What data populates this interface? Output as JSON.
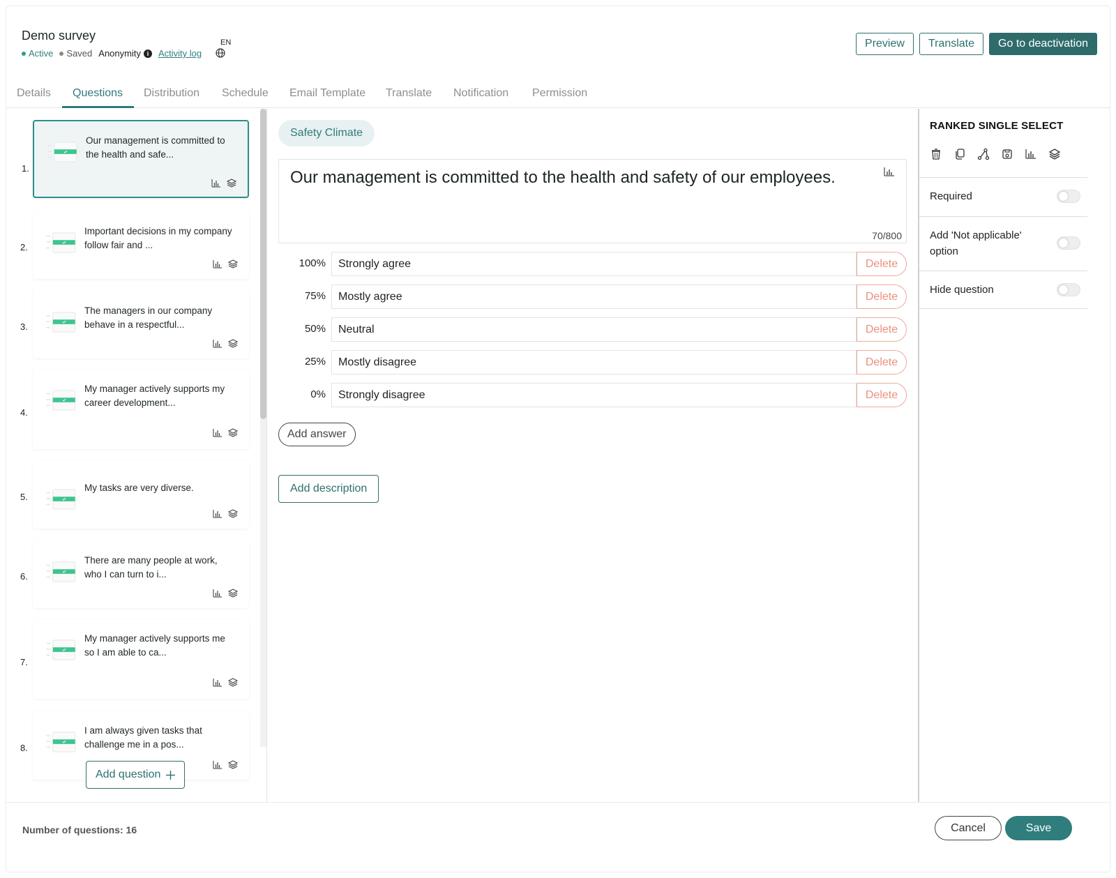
{
  "survey": {
    "title": "Demo survey",
    "status_active": "Active",
    "status_saved": "Saved",
    "anonymity_label": "Anonymity",
    "activity_log_label": "Activity log",
    "language": "EN"
  },
  "header_buttons": {
    "preview": "Preview",
    "translate": "Translate",
    "deactivate": "Go to deactivation"
  },
  "tabs": [
    {
      "label": "Details"
    },
    {
      "label": "Questions"
    },
    {
      "label": "Distribution"
    },
    {
      "label": "Schedule"
    },
    {
      "label": "Email Template"
    },
    {
      "label": "Translate"
    },
    {
      "label": "Notification"
    },
    {
      "label": "Permission"
    }
  ],
  "active_tab": "Questions",
  "questions": [
    {
      "num": "1.",
      "text": "Our management is committed to the health and safe..."
    },
    {
      "num": "2.",
      "text": "Important decisions in my company follow fair and ..."
    },
    {
      "num": "3.",
      "text": "The managers in our company behave in a respectful..."
    },
    {
      "num": "4.",
      "text": "My manager actively supports my career development..."
    },
    {
      "num": "5.",
      "text": "My tasks are very diverse."
    },
    {
      "num": "6.",
      "text": "There are many people at work, who I can turn to i..."
    },
    {
      "num": "7.",
      "text": "My manager actively supports me so I am able to ca..."
    },
    {
      "num": "8.",
      "text": "I am always given tasks that challenge me in a pos..."
    }
  ],
  "add_question_label": "Add question",
  "editor": {
    "category": "Safety Climate",
    "question_text": "Our management is committed to the health and safety of our employees.",
    "char_count": "70/800",
    "answers": [
      {
        "pct": "100%",
        "label": "Strongly agree"
      },
      {
        "pct": "75%",
        "label": "Mostly agree"
      },
      {
        "pct": "50%",
        "label": "Neutral"
      },
      {
        "pct": "25%",
        "label": "Mostly disagree"
      },
      {
        "pct": "0%",
        "label": "Strongly disagree"
      }
    ],
    "delete_label": "Delete",
    "add_answer_label": "Add answer",
    "add_description_label": "Add description"
  },
  "settings": {
    "type_title": "RANKED SINGLE SELECT",
    "tools": [
      "trash-icon",
      "copy-icon",
      "branch-logic-icon",
      "save-icon",
      "chart-icon",
      "layers-icon"
    ],
    "options": [
      {
        "label": "Required",
        "enabled": false
      },
      {
        "label": "Add 'Not applicable' option",
        "enabled": false
      },
      {
        "label": "Hide question",
        "enabled": false
      }
    ]
  },
  "footer": {
    "question_count": "Number of questions: 16",
    "cancel_label": "Cancel",
    "save_label": "Save"
  },
  "colors": {
    "primary": "#2f6f6f",
    "accent_green": "#3ec48f",
    "delete_red": "#ee8f7d"
  }
}
